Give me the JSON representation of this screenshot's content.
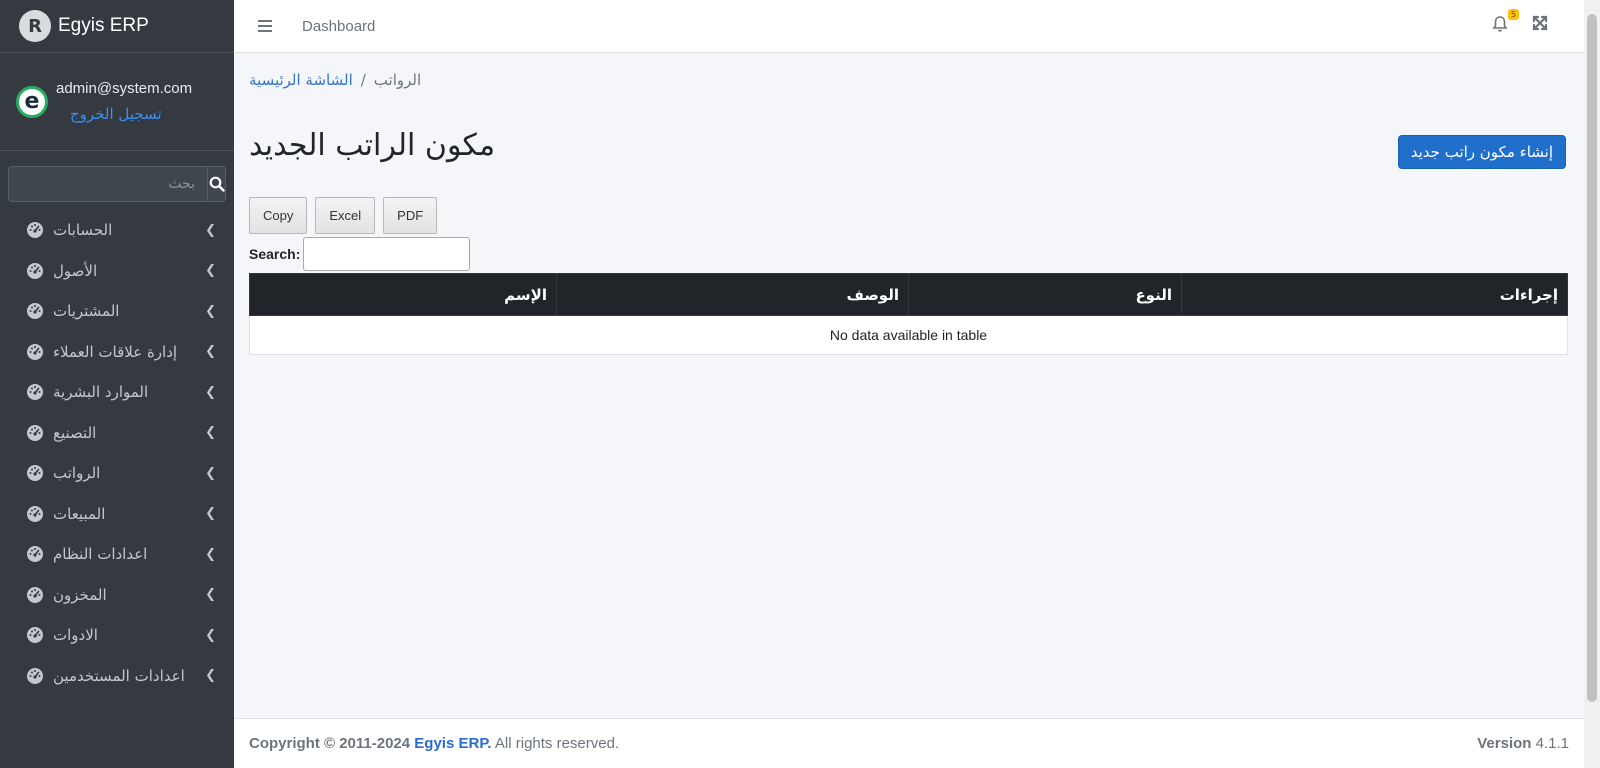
{
  "brand": {
    "name": "Egyis ERP",
    "logo_letter": "R"
  },
  "user": {
    "email": "admin@system.com",
    "logout_label": "تسجيل الخروج",
    "avatar_letter": "e"
  },
  "sidebar": {
    "search_placeholder": "بحث",
    "items": [
      {
        "label": "الحسابات"
      },
      {
        "label": "الأصول"
      },
      {
        "label": "المشتريات"
      },
      {
        "label": "إدارة علاقات العملاء"
      },
      {
        "label": "الموارد البشرية"
      },
      {
        "label": "التصنيع"
      },
      {
        "label": "الرواتب"
      },
      {
        "label": "المبيعات"
      },
      {
        "label": "اعدادات النظام"
      },
      {
        "label": "المخزون"
      },
      {
        "label": "الادوات"
      },
      {
        "label": "اعدادات المستخدمين"
      }
    ]
  },
  "header": {
    "dashboard_label": "Dashboard",
    "notification_count": "5"
  },
  "breadcrumb": {
    "home": "الشاشة الرئيسية",
    "separator": "/",
    "current": "الرواتب"
  },
  "page": {
    "title": "مكون الراتب الجديد",
    "create_button": "إنشاء مكون راتب جديد"
  },
  "datatable": {
    "buttons": [
      "Copy",
      "Excel",
      "PDF"
    ],
    "search_label": "Search:",
    "columns": [
      "الإسم",
      "الوصف",
      "النوع",
      "إجراءات"
    ],
    "empty_message": "No data available in table"
  },
  "footer": {
    "copyright_prefix": "Copyright © 2011-2024",
    "brand": "Egyis ERP.",
    "rights": "All rights reserved.",
    "version_label": "Version",
    "version": "4.1.1"
  },
  "colors": {
    "sidebar_bg": "#343a40",
    "primary": "#1f6fcb",
    "table_header": "#212529",
    "badge": "#ffc107"
  }
}
